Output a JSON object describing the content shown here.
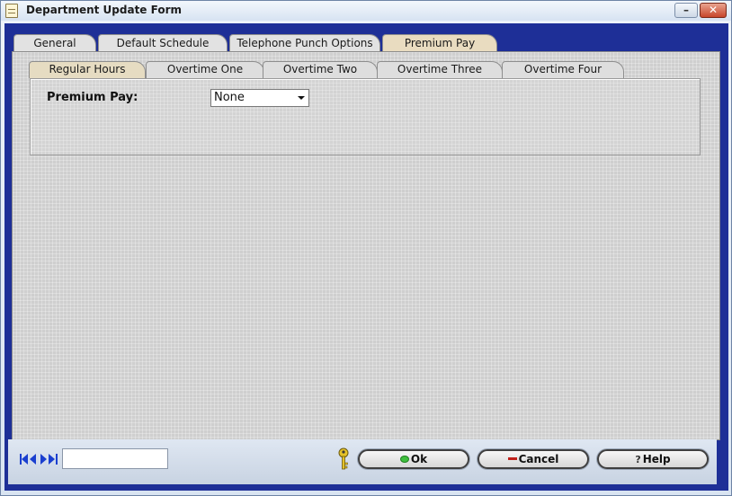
{
  "window": {
    "title": "Department Update Form",
    "minimize_label": "–",
    "close_label": "✕"
  },
  "tabs": [
    {
      "label": "General"
    },
    {
      "label": "Default Schedule"
    },
    {
      "label": "Telephone Punch Options"
    },
    {
      "label": "Premium Pay",
      "active": true
    }
  ],
  "subtabs": [
    {
      "label": "Regular Hours",
      "active": true
    },
    {
      "label": "Overtime One"
    },
    {
      "label": "Overtime Two"
    },
    {
      "label": "Overtime Three"
    },
    {
      "label": "Overtime Four"
    }
  ],
  "form": {
    "premium_pay_label": "Premium Pay:",
    "premium_pay_value": "None"
  },
  "footer": {
    "record_value": "",
    "ok_label": "Ok",
    "cancel_label": "Cancel",
    "help_label": "Help"
  },
  "icons": {
    "nav": "record-navigation-icons",
    "key": "key-icon"
  },
  "colors": {
    "frame": "#1e2f97",
    "panel": "#cfcfcf",
    "active_tab": "#e9dcc0"
  }
}
